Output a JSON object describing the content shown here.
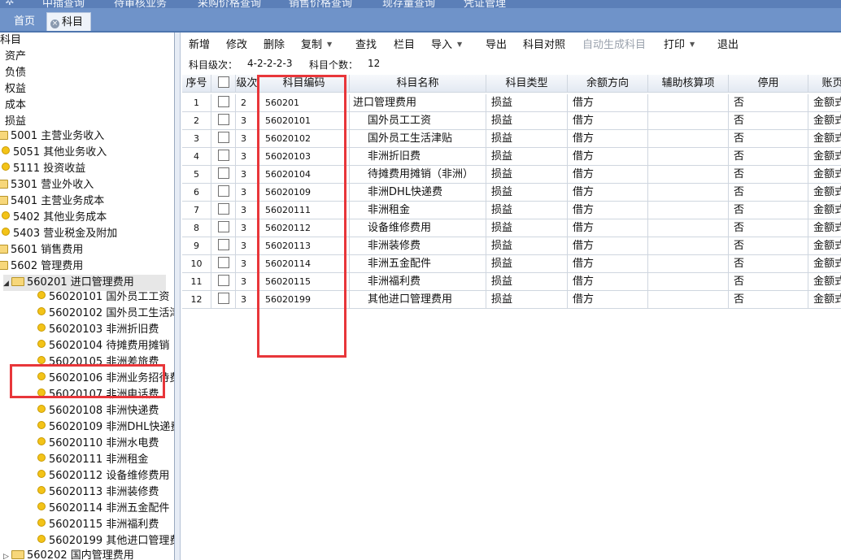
{
  "top_menu": [
    "中插查询",
    "待审核业务",
    "采购价格查询",
    "销售价格查询",
    "现存量查询",
    "凭证管理"
  ],
  "tabs": [
    {
      "label": "首页",
      "active": false
    },
    {
      "label": "科目",
      "active": true
    }
  ],
  "tree": {
    "categories": [
      "科目",
      "资产",
      "负债",
      "权益",
      "成本",
      "损益"
    ],
    "accounts": [
      {
        "code": "5001",
        "name": "主营业务收入"
      },
      {
        "code": "5051",
        "name": "其他业务收入"
      },
      {
        "code": "5111",
        "name": "投资收益"
      },
      {
        "code": "5301",
        "name": "营业外收入"
      },
      {
        "code": "5401",
        "name": "主营业务成本"
      },
      {
        "code": "5402",
        "name": "其他业务成本"
      },
      {
        "code": "5403",
        "name": "营业税金及附加"
      },
      {
        "code": "5601",
        "name": "销售费用"
      },
      {
        "code": "5602",
        "name": "管理费用"
      }
    ],
    "expanded_parent": {
      "code": "560201",
      "name": "进口管理费用"
    },
    "children": [
      {
        "code": "56020101",
        "name": "国外员工工资"
      },
      {
        "code": "56020102",
        "name": "国外员工生活津"
      },
      {
        "code": "56020103",
        "name": "非洲折旧费"
      },
      {
        "code": "56020104",
        "name": "待摊费用摊销（"
      },
      {
        "code": "56020105",
        "name": "非洲差旅费"
      },
      {
        "code": "56020106",
        "name": "非洲业务招待费"
      },
      {
        "code": "56020107",
        "name": "非洲电话费"
      },
      {
        "code": "56020108",
        "name": "非洲快递费"
      },
      {
        "code": "56020109",
        "name": "非洲DHL快递费"
      },
      {
        "code": "56020110",
        "name": "非洲水电费"
      },
      {
        "code": "56020111",
        "name": "非洲租金"
      },
      {
        "code": "56020112",
        "name": "设备维修费用"
      },
      {
        "code": "56020113",
        "name": "非洲装修费"
      },
      {
        "code": "56020114",
        "name": "非洲五金配件"
      },
      {
        "code": "56020115",
        "name": "非洲福利费"
      },
      {
        "code": "56020199",
        "name": "其他进口管理费"
      }
    ],
    "next_sibling": {
      "code": "560202",
      "name": "国内管理费用"
    }
  },
  "toolbar": {
    "add": "新增",
    "edit": "修改",
    "delete": "删除",
    "copy": "复制",
    "find": "查找",
    "columns": "栏目",
    "import": "导入",
    "export": "导出",
    "compare": "科目对照",
    "autogen": "自动生成科目",
    "print": "打印",
    "exit": "退出"
  },
  "info": {
    "level_label": "科目级次：",
    "level_value": "4-2-2-2-3",
    "count_label": "科目个数：",
    "count_value": "12"
  },
  "grid": {
    "headers": [
      "序号",
      "",
      "级次",
      "科目编码",
      "科目名称",
      "科目类型",
      "余额方向",
      "辅助核算项",
      "停用",
      "账页"
    ],
    "rows": [
      {
        "no": "1",
        "level": "2",
        "code": "560201",
        "name": "进口管理费用",
        "type": "损益",
        "direction": "借方",
        "aux": "",
        "disabled": "否",
        "page": "金额式"
      },
      {
        "no": "2",
        "level": "3",
        "code": "56020101",
        "name": "国外员工工资",
        "type": "损益",
        "direction": "借方",
        "aux": "",
        "disabled": "否",
        "page": "金额式"
      },
      {
        "no": "3",
        "level": "3",
        "code": "56020102",
        "name": "国外员工生活津贴",
        "type": "损益",
        "direction": "借方",
        "aux": "",
        "disabled": "否",
        "page": "金额式"
      },
      {
        "no": "4",
        "level": "3",
        "code": "56020103",
        "name": "非洲折旧费",
        "type": "损益",
        "direction": "借方",
        "aux": "",
        "disabled": "否",
        "page": "金额式"
      },
      {
        "no": "5",
        "level": "3",
        "code": "56020104",
        "name": "待摊费用摊销（非洲）",
        "type": "损益",
        "direction": "借方",
        "aux": "",
        "disabled": "否",
        "page": "金额式"
      },
      {
        "no": "6",
        "level": "3",
        "code": "56020109",
        "name": "非洲DHL快递费",
        "type": "损益",
        "direction": "借方",
        "aux": "",
        "disabled": "否",
        "page": "金额式"
      },
      {
        "no": "7",
        "level": "3",
        "code": "56020111",
        "name": "非洲租金",
        "type": "损益",
        "direction": "借方",
        "aux": "",
        "disabled": "否",
        "page": "金额式"
      },
      {
        "no": "8",
        "level": "3",
        "code": "56020112",
        "name": "设备维修费用",
        "type": "损益",
        "direction": "借方",
        "aux": "",
        "disabled": "否",
        "page": "金额式"
      },
      {
        "no": "9",
        "level": "3",
        "code": "56020113",
        "name": "非洲装修费",
        "type": "损益",
        "direction": "借方",
        "aux": "",
        "disabled": "否",
        "page": "金额式"
      },
      {
        "no": "10",
        "level": "3",
        "code": "56020114",
        "name": "非洲五金配件",
        "type": "损益",
        "direction": "借方",
        "aux": "",
        "disabled": "否",
        "page": "金额式"
      },
      {
        "no": "11",
        "level": "3",
        "code": "56020115",
        "name": "非洲福利费",
        "type": "损益",
        "direction": "借方",
        "aux": "",
        "disabled": "否",
        "page": "金额式"
      },
      {
        "no": "12",
        "level": "3",
        "code": "56020199",
        "name": "其他进口管理费用",
        "type": "损益",
        "direction": "借方",
        "aux": "",
        "disabled": "否",
        "page": "金额式"
      }
    ]
  },
  "colors": {
    "highlight_box": "#e8363a",
    "tab_bar": "#6f93c9",
    "folder": "#f7d77a",
    "leaf_dot": "#f3c318"
  }
}
